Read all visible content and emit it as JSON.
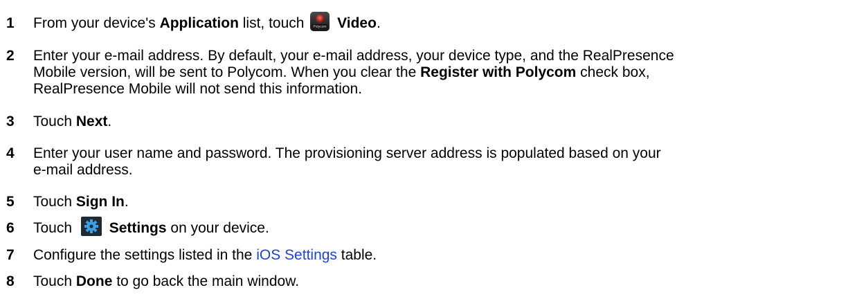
{
  "steps": [
    {
      "number": "1",
      "parts": [
        {
          "t": "From your device's "
        },
        {
          "b": "Application"
        },
        {
          "t": " list, touch "
        },
        {
          "icon": "video"
        },
        {
          "t": " "
        },
        {
          "b": "Video"
        },
        {
          "t": "."
        }
      ]
    },
    {
      "number": "2",
      "lines": [
        "Enter your e-mail address. By default, your e-mail address, your device type, and the RealPresence",
        "Mobile version, will be sent to Polycom. When you clear the ",
        "RealPresence Mobile will not send this information."
      ],
      "parts_line2": [
        {
          "t": "Mobile version, will be sent to Polycom. When you clear the "
        },
        {
          "b": "Register with Polycom"
        },
        {
          "t": " check box,"
        }
      ]
    },
    {
      "number": "3",
      "parts": [
        {
          "t": "Touch "
        },
        {
          "b": "Next"
        },
        {
          "t": "."
        }
      ]
    },
    {
      "number": "4",
      "lines": [
        "Enter your user name and password. The provisioning server address is populated based on your",
        "e-mail address."
      ]
    },
    {
      "number": "5",
      "parts": [
        {
          "t": "Touch "
        },
        {
          "b": "Sign In"
        },
        {
          "t": "."
        }
      ]
    },
    {
      "number": "6",
      "parts": [
        {
          "t": "Touch "
        },
        {
          "icon": "settings"
        },
        {
          "t": " "
        },
        {
          "b": "Settings"
        },
        {
          "t": " on your device."
        }
      ]
    },
    {
      "number": "7",
      "parts": [
        {
          "t": "Configure the settings listed in the "
        },
        {
          "link": "iOS Settings"
        },
        {
          "t": " table."
        }
      ]
    },
    {
      "number": "8",
      "parts": [
        {
          "t": "Touch "
        },
        {
          "b": "Done"
        },
        {
          "t": " to go back the main window."
        }
      ]
    }
  ],
  "icons": {
    "video": {
      "name": "polycom-video-app-icon",
      "label": "Polycom"
    },
    "settings": {
      "name": "settings-gear-icon"
    }
  },
  "colors": {
    "text": "#000000",
    "link": "#1c3fe0",
    "settings_icon_bg": "#1f2a33",
    "settings_icon_fg": "#3aa0e8",
    "video_icon_bg": "#2b2b2b",
    "video_icon_accent": "#c0392b"
  }
}
